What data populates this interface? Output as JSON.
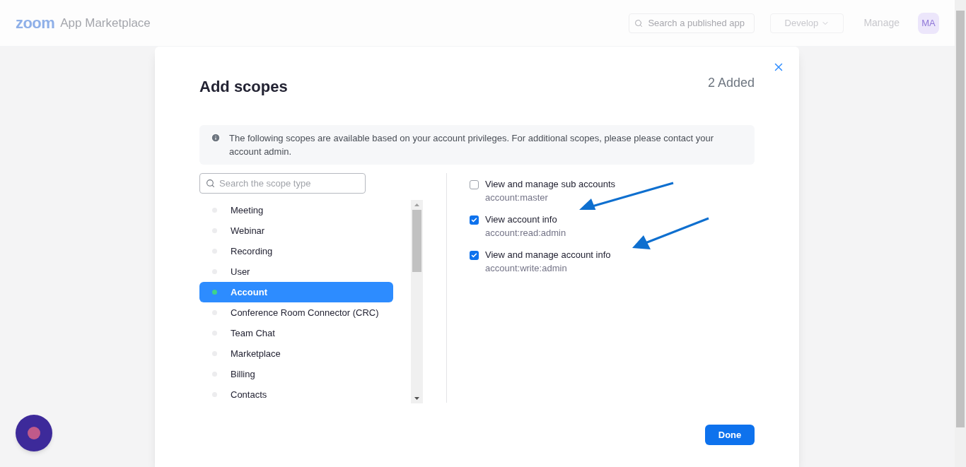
{
  "header": {
    "logo": "zoom",
    "app_name": "App Marketplace",
    "search": {
      "placeholder": "Search a published app"
    },
    "develop": "Develop",
    "manage": "Manage",
    "avatar": "MA"
  },
  "dialog": {
    "title": "Add scopes",
    "added": "2 Added",
    "info": "The following scopes are available based on your account privileges. For additional scopes, please please contact your account admin.",
    "search": {
      "placeholder": "Search the scope type"
    },
    "categories": [
      {
        "label": "Meeting",
        "selected": false
      },
      {
        "label": "Webinar",
        "selected": false
      },
      {
        "label": "Recording",
        "selected": false
      },
      {
        "label": "User",
        "selected": false
      },
      {
        "label": "Account",
        "selected": true
      },
      {
        "label": "Conference Room Connector (CRC)",
        "selected": false
      },
      {
        "label": "Team Chat",
        "selected": false
      },
      {
        "label": "Marketplace",
        "selected": false
      },
      {
        "label": "Billing",
        "selected": false
      },
      {
        "label": "Contacts",
        "selected": false
      }
    ],
    "scopes": [
      {
        "label": "View and manage sub accounts",
        "scope": "account:master",
        "checked": false
      },
      {
        "label": "View account info",
        "scope": "account:read:admin",
        "checked": true
      },
      {
        "label": "View and manage account info",
        "scope": "account:write:admin",
        "checked": true
      }
    ],
    "done": "Done"
  }
}
